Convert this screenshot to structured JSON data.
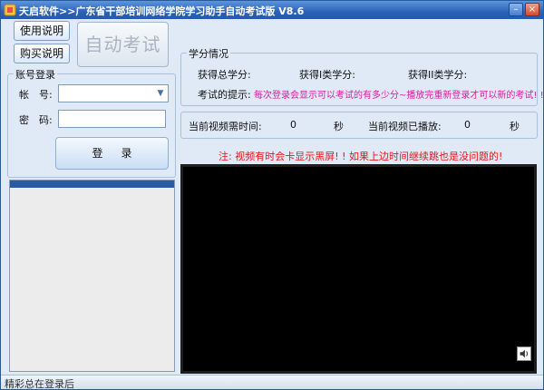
{
  "window": {
    "title": "天启软件>>广东省干部培训网络学院学习助手自动考试版 V8.6",
    "minimize_glyph": "–",
    "close_glyph": "×"
  },
  "buttons": {
    "usage": "使用说明",
    "purchase": "购买说明",
    "auto_exam": "自动考试",
    "login": "登录"
  },
  "account": {
    "title": "账号登录",
    "account_label": "帐　号:",
    "password_label": "密　码:",
    "account_value": "",
    "password_value": ""
  },
  "credits": {
    "title": "学分情况",
    "total_label": "获得总学分:",
    "class1_label": "获得I类学分:",
    "class2_label": "获得II类学分:",
    "hint_label": "考试的提示:",
    "hint_text": "每次登录会显示可以考试的有多少分~播放完重新登录才可以新的考试! !"
  },
  "video_info": {
    "needed_label": "当前视频需时间:",
    "needed_value": "0",
    "needed_unit": "秒",
    "played_label": "当前视频已播放:",
    "played_value": "0",
    "played_unit": "秒"
  },
  "warning": "注: 视频有时会卡显示黑屏! ! 如果上边时间继续跳也是没问题的!",
  "status": "精彩总在登录后"
}
